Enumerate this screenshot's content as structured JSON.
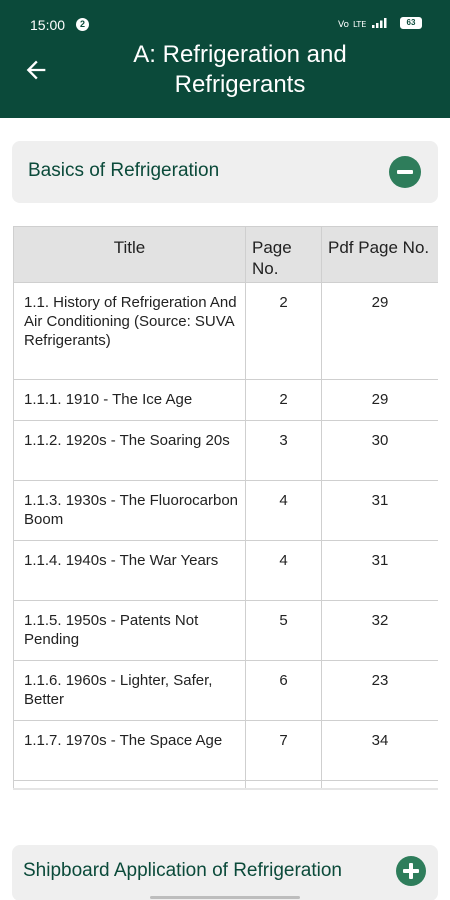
{
  "status_bar": {
    "time": "15:00",
    "notification_badge": "2",
    "indicators": "Vo LTE ᴸᵀᴱ.ıl",
    "battery": "63"
  },
  "app_bar": {
    "title": "A: Refrigeration and Refrigerants",
    "back_icon": "arrow-left-icon"
  },
  "section_open": {
    "title": "Basics of Refrigeration",
    "toggle_icon": "minus-circle-icon"
  },
  "table": {
    "headers": [
      "Title",
      "Page No.",
      "Pdf Page No."
    ],
    "rows": [
      {
        "title": "1.1. History of Refrigeration And Air Conditioning (Source: SUVA Refrigerants)",
        "page": "2",
        "pdf_page": "29"
      },
      {
        "title": "1.1.1. 1910 - The Ice Age",
        "page": "2",
        "pdf_page": "29"
      },
      {
        "title": "1.1.2. 1920s - The Soaring 20s",
        "page": "3",
        "pdf_page": "30"
      },
      {
        "title": "1.1.3. 1930s - The Fluorocarbon Boom",
        "page": "4",
        "pdf_page": "31"
      },
      {
        "title": "1.1.4. 1940s - The War Years",
        "page": "4",
        "pdf_page": "31"
      },
      {
        "title": "1.1.5. 1950s - Patents Not Pending",
        "page": "5",
        "pdf_page": "32"
      },
      {
        "title": "1.1.6. 1960s - Lighter, Safer, Better",
        "page": "6",
        "pdf_page": "23"
      },
      {
        "title": "1.1.7. 1970s - The Space Age",
        "page": "7",
        "pdf_page": "34"
      }
    ]
  },
  "section_collapsed": {
    "title": "Shipboard Application of Refrigeration",
    "toggle_icon": "plus-circle-icon"
  },
  "colors": {
    "primary": "#0b4a3a",
    "accent": "#2e7d5b",
    "card_bg": "#efefef",
    "header_bg": "#e2e2e2"
  }
}
